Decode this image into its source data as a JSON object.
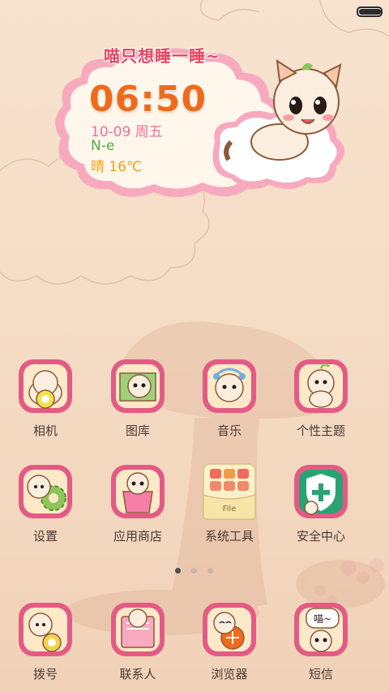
{
  "status_bar": {
    "battery_level": 0.95
  },
  "clock_widget": {
    "slogan": "喵只想睡一睡~",
    "time": "06:50",
    "date": "10-09 周五",
    "network": "N-e",
    "weather": "晴 16℃"
  },
  "apps": [
    {
      "label": "相机",
      "icon": "camera-icon"
    },
    {
      "label": "图库",
      "icon": "gallery-icon"
    },
    {
      "label": "音乐",
      "icon": "music-icon"
    },
    {
      "label": "个性主题",
      "icon": "themes-icon"
    },
    {
      "label": "设置",
      "icon": "settings-gear-icon"
    },
    {
      "label": "应用商店",
      "icon": "app-store-bag-icon"
    },
    {
      "label": "系统工具",
      "icon": "system-tools-folder-icon"
    },
    {
      "label": "安全中心",
      "icon": "security-shield-icon"
    }
  ],
  "tools_folder_text": "File",
  "page_indicator": {
    "count": 3,
    "active": 0
  },
  "dock": [
    {
      "label": "拨号",
      "icon": "phone-dialer-icon"
    },
    {
      "label": "联系人",
      "icon": "contacts-book-icon"
    },
    {
      "label": "浏览器",
      "icon": "browser-icon"
    },
    {
      "label": "短信",
      "icon": "messages-icon"
    }
  ],
  "messages_bubble_text": "喵~",
  "colors": {
    "time": "#f06a1d",
    "date": "#ef6e9a",
    "network": "#4db03b",
    "weather": "#f2a021",
    "icon_frame": "#e35b84",
    "cat_body": "#fbeedf"
  }
}
